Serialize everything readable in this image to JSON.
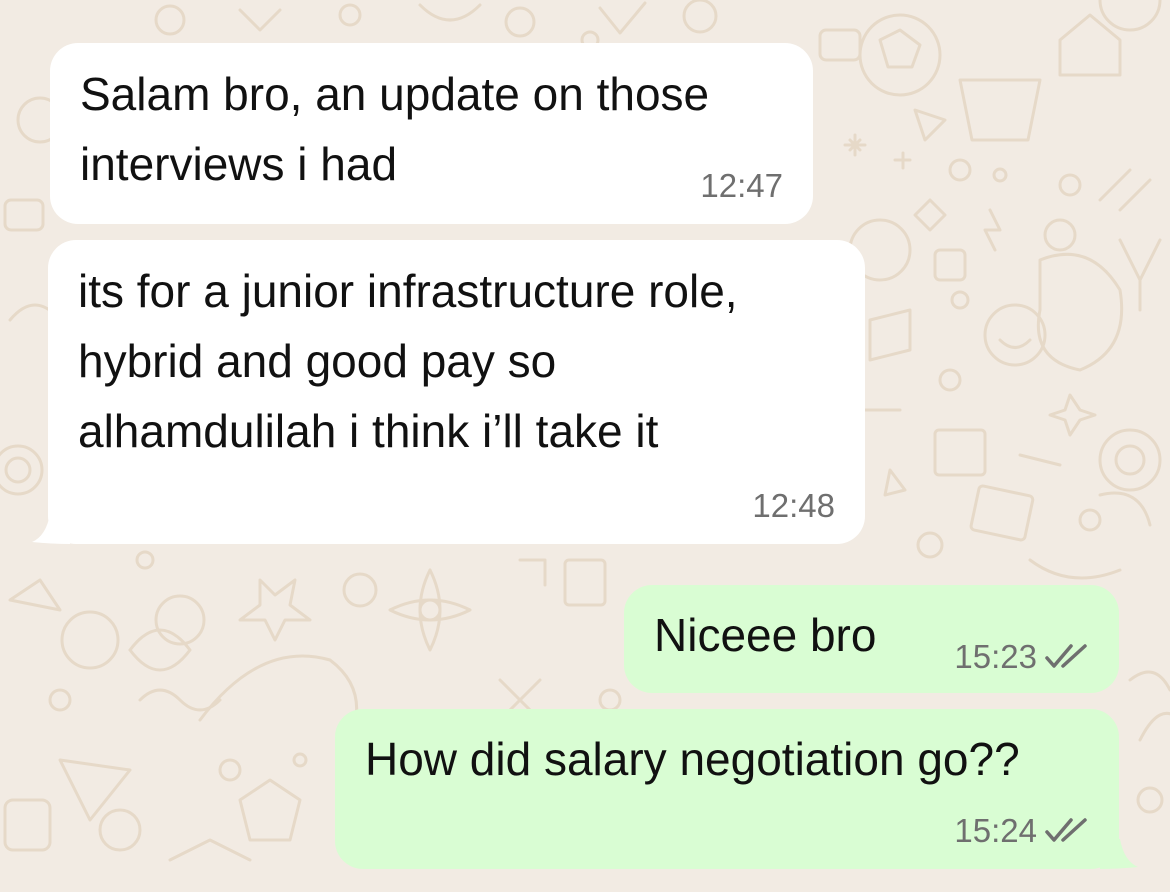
{
  "chat": {
    "messages": [
      {
        "direction": "incoming",
        "text": "Salam bro, an update on those\ninterviews i had",
        "time": "12:47"
      },
      {
        "direction": "incoming",
        "text": "its for a junior infrastructure role,\nhybrid and good pay so\nalhamdulilah i think i’ll take it",
        "time": "12:48"
      },
      {
        "direction": "outgoing",
        "text": "Niceee bro",
        "time": "15:23",
        "status_icon": "double-check-icon"
      },
      {
        "direction": "outgoing",
        "text": "How did salary negotiation go??",
        "time": "15:24",
        "status_icon": "double-check-icon"
      }
    ]
  },
  "colors": {
    "wallpaper": "#f2ebe3",
    "wallpaper_doodle": "#e7dccd",
    "incoming_bubble": "#ffffff",
    "outgoing_bubble": "#d9fdd3",
    "message_text": "#111111",
    "meta_text": "#6f6f6f"
  }
}
